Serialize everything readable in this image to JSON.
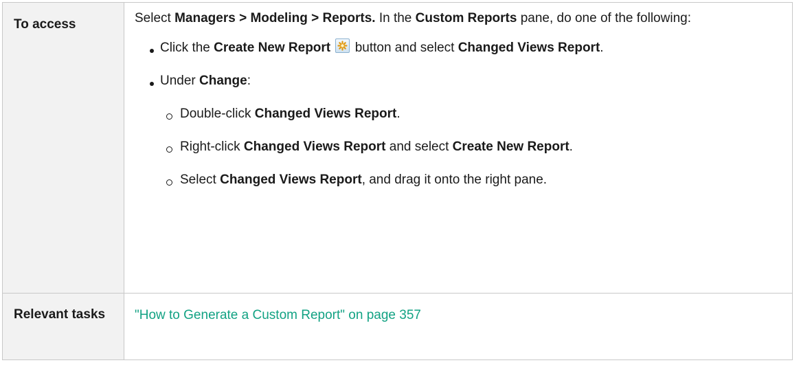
{
  "access": {
    "label": "To access",
    "intro": [
      {
        "t": "Select ",
        "b": false
      },
      {
        "t": "Managers > Modeling > Reports.",
        "b": true
      },
      {
        "t": " In the ",
        "b": false
      },
      {
        "t": "Custom Reports",
        "b": true
      },
      {
        "t": " pane, do one of the following:",
        "b": false
      }
    ],
    "bullets": [
      {
        "parts": [
          {
            "t": "Click the ",
            "b": false
          },
          {
            "t": "Create New Report",
            "b": true
          },
          {
            "icon": "create-new-report-icon"
          },
          {
            "t": " button and select ",
            "b": false
          },
          {
            "t": "Changed Views Report",
            "b": true
          },
          {
            "t": ".",
            "b": false
          }
        ]
      },
      {
        "parts": [
          {
            "t": "Under ",
            "b": false
          },
          {
            "t": "Change",
            "b": true
          },
          {
            "t": ":",
            "b": false
          }
        ],
        "sub": [
          [
            {
              "t": "Double-click ",
              "b": false
            },
            {
              "t": "Changed Views Report",
              "b": true
            },
            {
              "t": ".",
              "b": false
            }
          ],
          [
            {
              "t": "Right-click ",
              "b": false
            },
            {
              "t": "Changed Views Report",
              "b": true
            },
            {
              "t": " and select ",
              "b": false
            },
            {
              "t": "Create New Report",
              "b": true
            },
            {
              "t": ".",
              "b": false
            }
          ],
          [
            {
              "t": "Select ",
              "b": false
            },
            {
              "t": "Changed Views Report",
              "b": true
            },
            {
              "t": ", and drag it onto the right pane.",
              "b": false
            }
          ]
        ]
      }
    ]
  },
  "relevant": {
    "label": "Relevant tasks",
    "link_text": "\"How to Generate a Custom Report\" on page 357"
  },
  "colors": {
    "link": "#12a283",
    "header_bg": "#f2f2f2",
    "border": "#c8c8c8"
  }
}
